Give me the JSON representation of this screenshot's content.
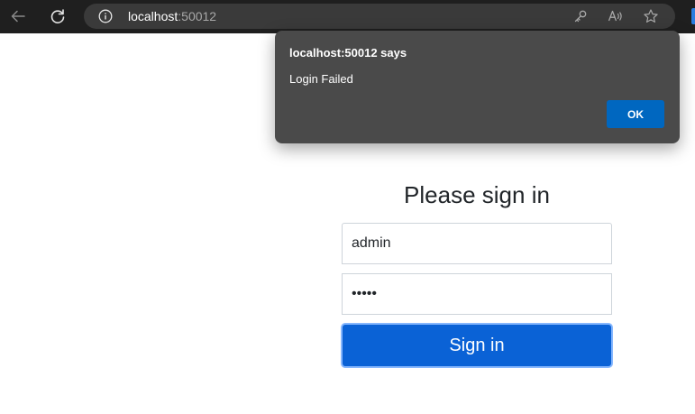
{
  "browser": {
    "url_host": "localhost",
    "url_port": ":50012",
    "icons": [
      "back-arrow-icon",
      "reload-icon",
      "info-icon",
      "key-icon",
      "read-aloud-icon",
      "favorite-star-icon"
    ]
  },
  "dialog": {
    "title": "localhost:50012 says",
    "message": "Login Failed",
    "ok_label": "OK",
    "ok_color": "#0067c0"
  },
  "login": {
    "heading": "Please sign in",
    "username_value": "admin",
    "password_value": "admin",
    "button_label": "Sign in",
    "button_color": "#0a62d6"
  }
}
